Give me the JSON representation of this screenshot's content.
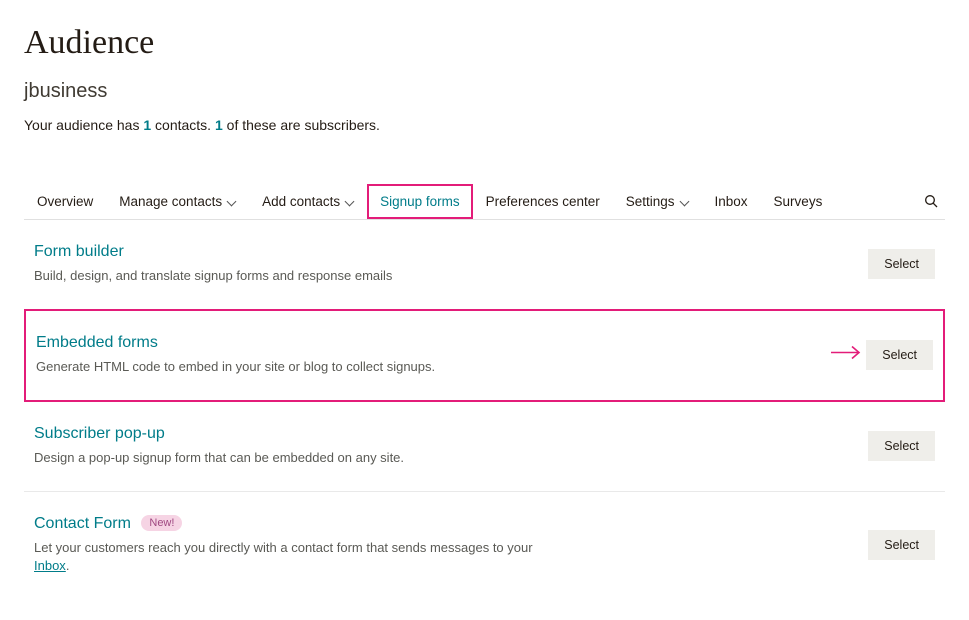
{
  "header": {
    "title": "Audience",
    "subtitle": "jbusiness",
    "summary_prefix": "Your audience has ",
    "contacts_count": "1",
    "summary_mid": " contacts. ",
    "subscribers_count": "1",
    "summary_suffix": " of these are subscribers."
  },
  "tabs": {
    "overview": "Overview",
    "manage_contacts": "Manage contacts",
    "add_contacts": "Add contacts",
    "signup_forms": "Signup forms",
    "preferences_center": "Preferences center",
    "settings": "Settings",
    "inbox": "Inbox",
    "surveys": "Surveys"
  },
  "rows": {
    "form_builder": {
      "title": "Form builder",
      "desc": "Build, design, and translate signup forms and response emails",
      "select": "Select"
    },
    "embedded_forms": {
      "title": "Embedded forms",
      "desc": "Generate HTML code to embed in your site or blog to collect signups.",
      "select": "Select"
    },
    "subscriber_popup": {
      "title": "Subscriber pop-up",
      "desc": "Design a pop-up signup form that can be embedded on any site.",
      "select": "Select"
    },
    "contact_form": {
      "title": "Contact Form",
      "badge": "New!",
      "desc_prefix": "Let your customers reach you directly with a contact form that sends messages to your ",
      "inbox_link": "Inbox",
      "desc_suffix": ".",
      "select": "Select"
    }
  }
}
